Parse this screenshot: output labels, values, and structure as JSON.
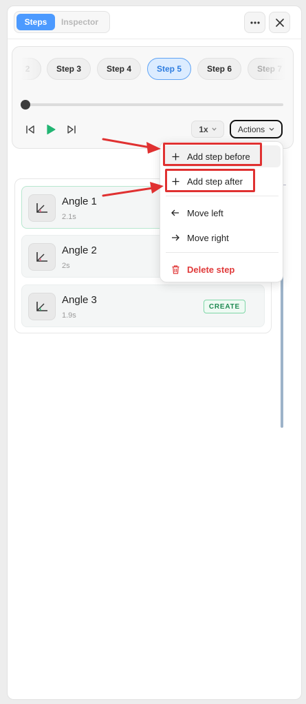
{
  "header": {
    "tabs": [
      {
        "label": "Steps",
        "active": true
      },
      {
        "label": "Inspector",
        "active": false
      }
    ],
    "more_icon": "ellipsis-icon",
    "close_icon": "close-icon"
  },
  "player": {
    "steps": [
      {
        "label": "2",
        "active": false,
        "faded": true
      },
      {
        "label": "Step 3",
        "active": false
      },
      {
        "label": "Step 4",
        "active": false
      },
      {
        "label": "Step 5",
        "active": true
      },
      {
        "label": "Step 6",
        "active": false
      },
      {
        "label": "Step 7",
        "active": false,
        "faded": true
      }
    ],
    "progress": 0.0,
    "speed_label": "1x",
    "actions_label": "Actions"
  },
  "step_list": {
    "items": [
      {
        "title": "Angle 1",
        "duration": "2.1s"
      },
      {
        "title": "Angle 2",
        "duration": "2s"
      },
      {
        "title": "Angle 3",
        "duration": "1.9s",
        "badge": "CREATE"
      }
    ]
  },
  "menu": {
    "items": [
      {
        "label": "Add step before",
        "icon": "plus-icon"
      },
      {
        "label": "Add step after",
        "icon": "plus-icon"
      },
      {
        "label": "Move left",
        "icon": "arrow-left-icon"
      },
      {
        "label": "Move right",
        "icon": "arrow-right-icon"
      },
      {
        "label": "Delete step",
        "icon": "trash-icon"
      }
    ]
  },
  "colors": {
    "accent": "#4c9aff",
    "active_step_bg": "#dcecff",
    "play_green": "#22b573",
    "danger": "#e03a3a",
    "annotation_red": "#e03131",
    "create_badge": "#1f8a52"
  }
}
